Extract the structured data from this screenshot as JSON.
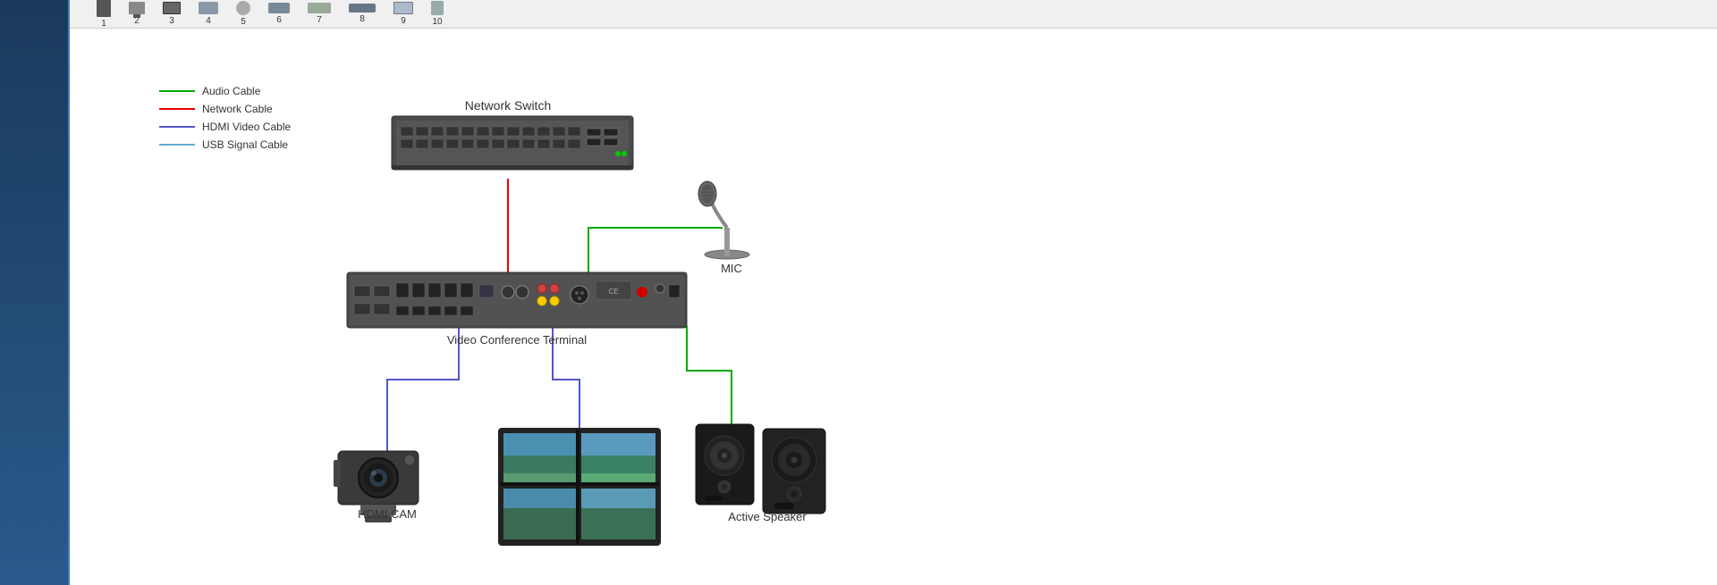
{
  "sidebar": {
    "bg_color": "#1a3a5c"
  },
  "thumbnail_bar": {
    "items": [
      {
        "id": 1,
        "label": "1"
      },
      {
        "id": 2,
        "label": "2"
      },
      {
        "id": 3,
        "label": "3"
      },
      {
        "id": 4,
        "label": "4"
      },
      {
        "id": 5,
        "label": "5"
      },
      {
        "id": 6,
        "label": "6"
      },
      {
        "id": 7,
        "label": "7"
      },
      {
        "id": 8,
        "label": "8"
      },
      {
        "id": 9,
        "label": "9"
      },
      {
        "id": 10,
        "label": "10"
      }
    ]
  },
  "legend": {
    "items": [
      {
        "label": "Audio Cable",
        "color": "#00aa00"
      },
      {
        "label": "Network Cable",
        "color": "#ee0000"
      },
      {
        "label": "HDMI Video Cable",
        "color": "#5555cc"
      },
      {
        "label": "USB Signal Cable",
        "color": "#66aacc"
      }
    ]
  },
  "devices": {
    "network_switch": {
      "label": "Network Switch"
    },
    "video_conference": {
      "label": "Video Conference Terminal"
    },
    "mic": {
      "label": "MIC"
    },
    "hdmi_cam": {
      "label": "HDMI CAM"
    },
    "display": {
      "label": ""
    },
    "active_speaker": {
      "label": "Active Speaker"
    }
  }
}
